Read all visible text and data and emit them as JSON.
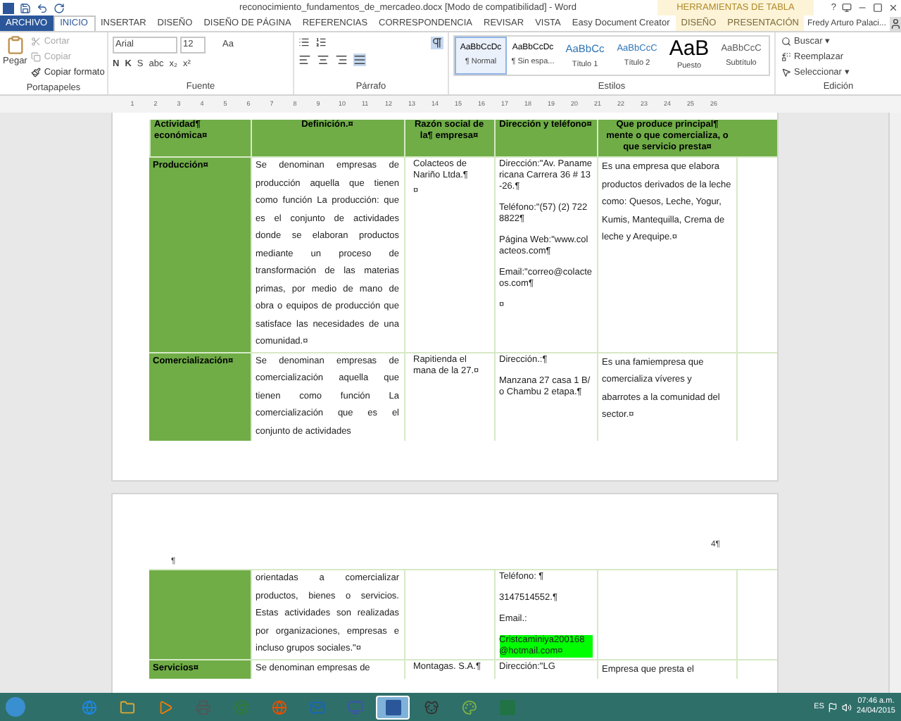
{
  "title_bar": {
    "title": "reconocimiento_fundamentos_de_mercadeo.docx [Modo de compatibilidad] - Word",
    "context_group": "HERRAMIENTAS DE TABLA",
    "help": "?"
  },
  "tabs": [
    {
      "label": "ARCHIVO",
      "kind": "file",
      "selected": false
    },
    {
      "label": "INICIO",
      "kind": "normal",
      "selected": true
    },
    {
      "label": "INSERTAR",
      "kind": "normal",
      "selected": false
    },
    {
      "label": "DISEÑO",
      "kind": "normal",
      "selected": false
    },
    {
      "label": "DISEÑO DE PÁGINA",
      "kind": "normal",
      "selected": false
    },
    {
      "label": "REFERENCIAS",
      "kind": "normal",
      "selected": false
    },
    {
      "label": "CORRESPONDENCIA",
      "kind": "normal",
      "selected": false
    },
    {
      "label": "REVISAR",
      "kind": "normal",
      "selected": false
    },
    {
      "label": "VISTA",
      "kind": "normal",
      "selected": false
    },
    {
      "label": "Easy Document Creator",
      "kind": "normal",
      "selected": false
    },
    {
      "label": "DISEÑO",
      "kind": "context",
      "selected": false
    },
    {
      "label": "PRESENTACIÓN",
      "kind": "context",
      "selected": false
    }
  ],
  "user": "Fredy Arturo Palaci...",
  "clipboard": {
    "paste": "Pegar",
    "items": [
      {
        "label": "Cortar",
        "disabled": true
      },
      {
        "label": "Copiar",
        "disabled": true
      },
      {
        "label": "Copiar formato",
        "disabled": false
      }
    ],
    "label": "Portapapeles"
  },
  "font": {
    "name": "Arial",
    "size": "12",
    "format_buttons": [
      "N",
      "K",
      "S",
      "abc",
      "x₂",
      "x²"
    ],
    "case": "Aa",
    "label": "Fuente"
  },
  "paragraph": {
    "label": "Párrafo",
    "align": [
      {
        "kind": "left",
        "selected": false
      },
      {
        "kind": "center",
        "selected": false
      },
      {
        "kind": "right",
        "selected": false
      },
      {
        "kind": "justify",
        "selected": true
      }
    ],
    "show_marks": {
      "selected": true
    }
  },
  "styles": {
    "label": "Estilos",
    "items": [
      {
        "preview": "AaBbCcDc",
        "name": "¶ Normal",
        "kind": "normal",
        "selected": true
      },
      {
        "preview": "AaBbCcDc",
        "name": "¶ Sin espa...",
        "kind": "normal",
        "selected": false
      },
      {
        "preview": "AaBbCc",
        "name": "Título 1",
        "kind": "heading1",
        "selected": false
      },
      {
        "preview": "AaBbCcC",
        "name": "Título 2",
        "kind": "heading2",
        "selected": false
      },
      {
        "preview": "AaB",
        "name": "Puesto",
        "kind": "title",
        "selected": false
      },
      {
        "preview": "AaBbCcC",
        "name": "Subtítulo",
        "kind": "subtitle",
        "selected": false
      }
    ]
  },
  "editing": {
    "label": "Edición",
    "items": [
      {
        "label": "Buscar ▾",
        "kind": "find"
      },
      {
        "label": "Reemplazar",
        "kind": "replace"
      },
      {
        "label": "Seleccionar ▾",
        "kind": "select"
      }
    ]
  },
  "ruler": [
    "1",
    "2",
    "3",
    "4",
    "5",
    "6",
    "7",
    "8",
    "9",
    "10",
    "11",
    "12",
    "13",
    "14",
    "15",
    "16",
    "17",
    "18",
    "19",
    "20",
    "21",
    "22",
    "23",
    "24",
    "25",
    "26"
  ],
  "page1": {
    "columns": [
      "Actividad¶ económica¤",
      "Definición.¤",
      "Razón social de la¶ empresa¤",
      "Dirección y teléfono¤",
      "Que produce principal¶ mente o que comercializa, o que servicio presta¤"
    ],
    "rows": [
      {
        "activity": "Producción¤",
        "definition": "Se denominan empresas de producción aquella que tienen como función La producción: que es el conjunto de actividades donde se elaboran productos mediante un proceso de transformación de las materias primas, por medio de mano de obra o equipos de producción que satisface las necesidades de una comunidad.¤",
        "company": [
          "Colacteos de Nariño Ltda.¶",
          "¤"
        ],
        "address": [
          "Dirección:\"Av. Panamericana Carrera 36 # 13-26.¶",
          "Teléfono:\"(57) (2) 7228822¶",
          "Página Web:\"www.colacteos.com¶",
          "Email:\"correo@colacteos.com¶",
          "¤"
        ],
        "product": "Es una empresa que elabora productos derivados de la leche como: Quesos, Leche, Yogur, Kumis, Mantequilla, Crema de leche y Arequipe.¤"
      },
      {
        "activity": "Comercialización¤",
        "definition": "Se denominan empresas de comercialización aquella que tienen como función La comercialización que es el conjunto de actividades",
        "company": [
          "Rapitienda el mana de la 27.¤"
        ],
        "address": [
          "Dirección.:¶",
          "Manzana 27 casa 1 B/o Chambu 2 etapa.¶"
        ],
        "product": "Es una famiempresa que comercializa víveres y abarrotes a la comunidad del sector.¤"
      }
    ]
  },
  "page2": {
    "header_mark": "4¶",
    "left_mark": "¶",
    "rows": [
      {
        "activity": "",
        "definition": "orientadas a comercializar productos, bienes o servicios. Estas actividades son realizadas por organizaciones, empresas e incluso grupos sociales.\"¤",
        "company": [],
        "address": [
          "Teléfono: ¶",
          "3147514552.¶",
          "Email.: ",
          "Cristcaminiya200168@hotmail.com¤"
        ],
        "product": ""
      },
      {
        "activity": "Servicios¤",
        "definition": "Se denominan empresas de",
        "company": [
          "Montagas. S.A.¶"
        ],
        "address": [
          "Dirección:\"LG"
        ],
        "product": "Empresa que presta el"
      }
    ]
  },
  "taskbar": {
    "apps": [
      {
        "kind": "ie",
        "selected": false
      },
      {
        "kind": "folder",
        "selected": false
      },
      {
        "kind": "media",
        "selected": false
      },
      {
        "kind": "printer",
        "selected": false
      },
      {
        "kind": "chrome",
        "selected": false
      },
      {
        "kind": "firefox",
        "selected": false
      },
      {
        "kind": "outlook",
        "selected": false
      },
      {
        "kind": "panel",
        "selected": false
      },
      {
        "kind": "word",
        "selected": true
      },
      {
        "kind": "dog",
        "selected": false
      },
      {
        "kind": "paint",
        "selected": false
      },
      {
        "kind": "excel",
        "selected": false
      }
    ],
    "language": "ES",
    "time": "07:46 a.m.",
    "date": "24/04/2015"
  }
}
